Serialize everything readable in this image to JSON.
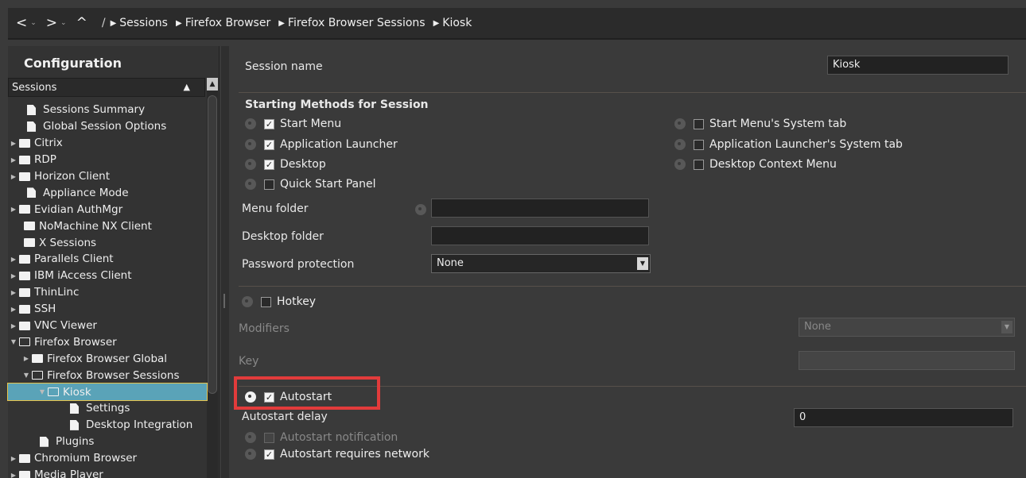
{
  "toolbar": {
    "back": "<",
    "forward": ">",
    "up": "^",
    "root": "/",
    "breadcrumbs": [
      "Sessions",
      "Firefox Browser",
      "Firefox Browser Sessions",
      "Kiosk"
    ]
  },
  "sidebar": {
    "title": "Configuration",
    "header": "Sessions",
    "items": [
      {
        "label": "Sessions Summary"
      },
      {
        "label": "Global Session Options"
      },
      {
        "label": "Citrix"
      },
      {
        "label": "RDP"
      },
      {
        "label": "Horizon Client"
      },
      {
        "label": "Appliance Mode"
      },
      {
        "label": "Evidian AuthMgr"
      },
      {
        "label": "NoMachine NX Client"
      },
      {
        "label": "X Sessions"
      },
      {
        "label": "Parallels Client"
      },
      {
        "label": "IBM iAccess Client"
      },
      {
        "label": "ThinLinc"
      },
      {
        "label": "SSH"
      },
      {
        "label": "VNC Viewer"
      },
      {
        "label": "Firefox Browser"
      },
      {
        "label": "Firefox Browser Global"
      },
      {
        "label": "Firefox Browser Sessions"
      },
      {
        "label": "Kiosk"
      },
      {
        "label": "Settings"
      },
      {
        "label": "Desktop Integration"
      },
      {
        "label": "Plugins"
      },
      {
        "label": "Chromium Browser"
      },
      {
        "label": "Media Player"
      }
    ]
  },
  "form": {
    "session_name_label": "Session name",
    "session_name_value": "Kiosk",
    "starting_methods_title": "Starting Methods for Session",
    "start_menu": "Start Menu",
    "app_launcher": "Application Launcher",
    "desktop": "Desktop",
    "quick_start_panel": "Quick Start Panel",
    "start_menu_system_tab": "Start Menu's System tab",
    "app_launcher_system_tab": "Application Launcher's System tab",
    "desktop_context_menu": "Desktop Context Menu",
    "menu_folder_label": "Menu folder",
    "desktop_folder_label": "Desktop folder",
    "password_protection_label": "Password protection",
    "password_protection_value": "None",
    "hotkey": "Hotkey",
    "modifiers_label": "Modifiers",
    "modifiers_value": "None",
    "key_label": "Key",
    "autostart": "Autostart",
    "autostart_delay_label": "Autostart delay",
    "autostart_delay_value": "0",
    "autostart_notification": "Autostart notification",
    "autostart_requires_network": "Autostart requires network"
  },
  "colors": {
    "selection": "#5aa3b8",
    "highlight_box": "#e23b3b"
  }
}
